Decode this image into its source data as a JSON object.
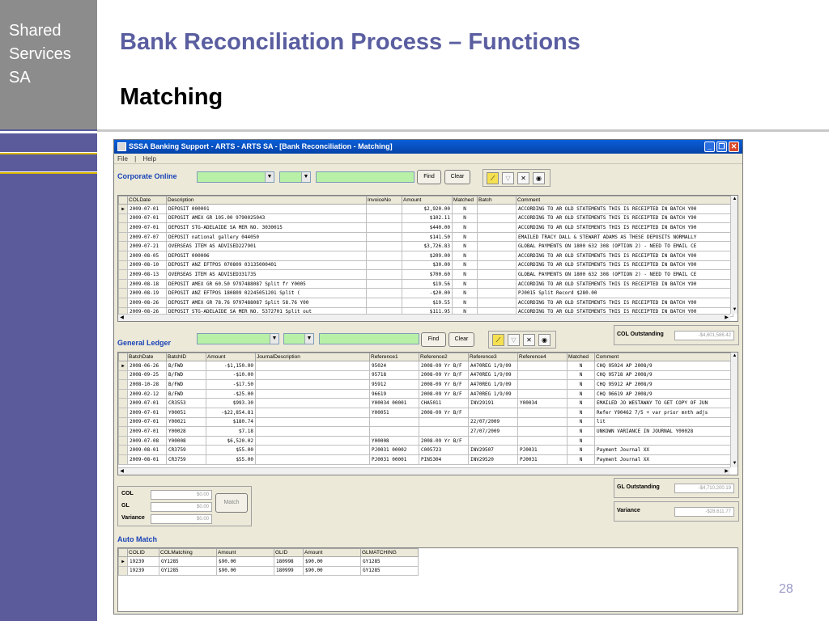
{
  "brand": [
    "Shared",
    "Services",
    "SA"
  ],
  "slide": {
    "title": "Bank Reconciliation Process – Functions",
    "subtitle": "Matching",
    "page_number": "28"
  },
  "window": {
    "title": "SSSA Banking Support - ARTS - ARTS SA - [Bank Reconciliation - Matching]",
    "menu": [
      "File",
      "|",
      "Help"
    ],
    "min_icon": "minimize-icon",
    "restore_icon": "restore-icon",
    "close_icon": "close-icon"
  },
  "corporate_online": {
    "label": "Corporate Online",
    "find_label": "Find",
    "clear_label": "Clear",
    "columns": [
      "COLDate",
      "Description",
      "InvoiceNo",
      "Amount",
      "Matched",
      "Batch",
      "Comment"
    ],
    "rows": [
      [
        "2009-07-01",
        "DEPOSIT 000001",
        "",
        "$2,920.00",
        "N",
        "",
        "ACCORDING TO AR OLD STATEMENTS THIS IS RECEIPTED IN BATCH Y00"
      ],
      [
        "2009-07-01",
        "DEPOSIT AMEX GR   105.00        9790025043",
        "",
        "$102.11",
        "N",
        "",
        "ACCORDING TO AR OLD STATEMENTS THIS IS RECEIPTED IN BATCH Y90"
      ],
      [
        "2009-07-01",
        "DEPOSIT STG-ADELAIDE SA         MER NO. 3030015",
        "",
        "$440.00",
        "N",
        "",
        "ACCORDING TO AR OLD STATEMENTS THIS IS RECEIPTED IN BATCH Y90"
      ],
      [
        "2009-07-07",
        "DEPOSIT national gallery        044050",
        "",
        "$141.50",
        "N",
        "",
        "EMAILED TRACY DALL & STEWART ADAMS AS THESE DEPOSITS NORMALLY"
      ],
      [
        "2009-07-21",
        "OVERSEAS ITEM AS ADVISED227901",
        "",
        "$3,726.83",
        "N",
        "",
        "GLOBAL PAYMENTS ON 1800 632 308 (OPTION 2) - NEED TO EMAIL CE"
      ],
      [
        "2009-08-05",
        "DEPOSIT 000006",
        "",
        "$209.00",
        "N",
        "",
        "ACCORDING TO AR OLD STATEMENTS THIS IS RECEIPTED IN BATCH Y00"
      ],
      [
        "2009-08-10",
        "DEPOSIT ANZ EFTPOS              070809 03135000401",
        "",
        "$30.00",
        "N",
        "",
        "ACCORDING TO AR OLD STATEMENTS THIS IS RECEIPTED IN BATCH Y00"
      ],
      [
        "2009-08-13",
        "OVERSEAS ITEM AS ADVISED331735",
        "",
        "$700.60",
        "N",
        "",
        "GLOBAL PAYMENTS ON 1800 632 308 (OPTION 2) - NEED TO EMAIL CE"
      ],
      [
        "2009-08-18",
        "DEPOSIT AMEX GR    60.50        9797488087  Split fr Y0005",
        "",
        "$19.56",
        "N",
        "",
        "ACCORDING TO AR OLD STATEMENTS THIS IS RECEIPTED IN BATCH Y90"
      ],
      [
        "2009-08-19",
        "DEPOSIT ANZ EFTPOS              180809 02245051201 Split (",
        "",
        "-$20.00",
        "N",
        "",
        "PJ0015 Split Record $280.00"
      ],
      [
        "2009-08-26",
        "DEPOSIT AMEX GR    78.76        9797488087 Split 58.76 Y00",
        "",
        "$19.55",
        "N",
        "",
        "ACCORDING TO AR OLD STATEMENTS THIS IS RECEIPTED IN BATCH Y00"
      ],
      [
        "2009-08-26",
        "DEPOSIT STG-ADELAIDE SA         MER NO. 5372701 Split out",
        "",
        "$111.95",
        "N",
        "",
        "ACCORDING TO AR OLD STATEMENTS THIS IS RECEIPTED IN BATCH Y00"
      ]
    ]
  },
  "general_ledger": {
    "label": "General Ledger",
    "find_label": "Find",
    "clear_label": "Clear",
    "columns": [
      "BatchDate",
      "BatchID",
      "Amount",
      "JournalDescription",
      "Reference1",
      "Reference2",
      "Reference3",
      "Reference4",
      "Matched",
      "Comment"
    ],
    "rows": [
      [
        "2008-06-26",
        "B/FWD",
        "-$1,150.00",
        "",
        "95024",
        "2008-09 Yr B/F",
        "A470REG 1/9/09",
        "",
        "N",
        "CHQ 95024 AP 2008/9"
      ],
      [
        "2008-09-25",
        "B/FWD",
        "-$10.00",
        "",
        "95718",
        "2008-09 Yr B/F",
        "A470REG 1/9/09",
        "",
        "N",
        "CHQ 95718 AP 2008/9"
      ],
      [
        "2008-10-28",
        "B/FWD",
        "-$17.50",
        "",
        "95912",
        "2008-09 Yr B/F",
        "A470REG 1/9/09",
        "",
        "N",
        "CHQ 95912 AP 2008/9"
      ],
      [
        "2009-02-12",
        "B/FWD",
        "-$25.00",
        "",
        "96619",
        "2008-09 Yr B/F",
        "A470REG 1/9/09",
        "",
        "N",
        "CHQ 96619 AP 2008/9"
      ],
      [
        "2009-07-01",
        "CR3553",
        "$993.30",
        "",
        "Y00034 00001",
        "CHA5011",
        "INV29191",
        "Y00034",
        "N",
        "EMAILED JO WESTAWAY TO GET COPY OF JUN"
      ],
      [
        "2009-07-01",
        "Y00051",
        "-$22,854.81",
        "",
        "Y00051",
        "2008-09 Yr B/F",
        "",
        "",
        "N",
        "Refer Y90462 7/5 + var prior mnth adjs"
      ],
      [
        "2009-07-01",
        "Y00021",
        "$180.74",
        "",
        "",
        "",
        "22/07/2009",
        "",
        "N",
        "lit"
      ],
      [
        "2009-07-01",
        "Y00028",
        "$7.18",
        "",
        "",
        "",
        "27/07/2009",
        "",
        "N",
        "UNKOWN VARIANCE IN JOURNAL Y00028"
      ],
      [
        "2009-07-08",
        "Y00008",
        "$6,520.02",
        "",
        "Y00008",
        "2008-09 Yr B/F",
        "",
        "",
        "N",
        ""
      ],
      [
        "2009-08-01",
        "CR3759",
        "$55.00",
        "",
        "PJ0031 00002",
        "C005723",
        "INV29507",
        "PJ0031",
        "N",
        "Payment Journal XX"
      ],
      [
        "2009-08-01",
        "CR3759",
        "$55.00",
        "",
        "PJ0031 00001",
        "PIN5304",
        "INV29520",
        "PJ0031",
        "N",
        "Payment Journal XX"
      ]
    ],
    "col_outstanding_label": "COL Outstanding",
    "col_outstanding_value": "-$4,601,586.42"
  },
  "totals": {
    "col_label": "COL",
    "col_value": "$0.00",
    "gl_label": "GL",
    "gl_value": "$0.00",
    "variance_label": "Variance",
    "variance_value": "$0.00",
    "match_label": "Match",
    "gl_outstanding_label": "GL Outstanding",
    "gl_outstanding_value": "-$4,710,200.19",
    "variance_panel_label": "Variance",
    "variance_panel_value": "-$28,611.77"
  },
  "auto_match": {
    "label": "Auto Match",
    "columns": [
      "COLID",
      "COLMatching",
      "Amount",
      "GLID",
      "Amount",
      "GLMATCHING"
    ],
    "rows": [
      [
        "19239",
        "GY1285",
        "$90.00",
        "180998",
        "$90.00",
        "GY1285"
      ],
      [
        "19239",
        "GY1285",
        "$90.00",
        "180999",
        "$90.00",
        "GY1285"
      ]
    ]
  },
  "colors": {
    "accent": "#5a5ea0",
    "sidebar": "#5b5b9c",
    "sidebar_top": "#8c8c8c",
    "gold": "#d9b500",
    "field_green": "#b8f0a8",
    "label_blue": "#1a44b8"
  }
}
